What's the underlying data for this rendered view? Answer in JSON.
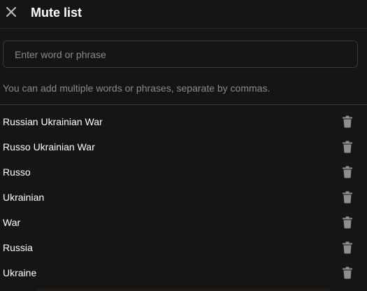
{
  "header": {
    "title": "Mute list",
    "close_icon": "close-icon"
  },
  "input": {
    "placeholder": "Enter word or phrase",
    "value": ""
  },
  "helper_text": "You can add multiple words or phrases, separate by commas.",
  "muted_items": [
    {
      "label": "Russian Ukrainian War",
      "icon": "trash-icon"
    },
    {
      "label": "Russo Ukrainian War",
      "icon": "trash-icon"
    },
    {
      "label": "Russo",
      "icon": "trash-icon"
    },
    {
      "label": "Ukrainian",
      "icon": "trash-icon"
    },
    {
      "label": "War",
      "icon": "trash-icon"
    },
    {
      "label": "Russia",
      "icon": "trash-icon"
    },
    {
      "label": "Ukraine",
      "icon": "trash-icon"
    }
  ],
  "colors": {
    "background": "#151515",
    "text": "#ffffff",
    "muted_text": "#8a8a8a",
    "border": "#3a3a3a",
    "icon": "#8e8e8e"
  }
}
